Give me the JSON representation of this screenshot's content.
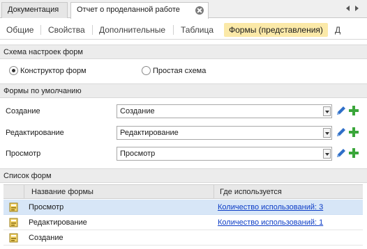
{
  "doc_tabs": [
    {
      "label": "Документация"
    },
    {
      "label": "Отчет о проделанной работе"
    }
  ],
  "prop_tabs": [
    {
      "label": "Общие"
    },
    {
      "label": "Свойства"
    },
    {
      "label": "Дополнительные"
    },
    {
      "label": "Таблица"
    },
    {
      "label": "Формы (представления)"
    },
    {
      "label": "Д"
    }
  ],
  "scheme": {
    "header": "Схема настроек форм",
    "option_constructor": "Конструктор форм",
    "option_simple": "Простая схема",
    "selected": "Конструктор форм"
  },
  "defaults": {
    "header": "Формы по умолчанию",
    "rows": [
      {
        "label": "Создание",
        "value": "Создание"
      },
      {
        "label": "Редактирование",
        "value": "Редактирование"
      },
      {
        "label": "Просмотр",
        "value": "Просмотр"
      }
    ]
  },
  "forms_list": {
    "header": "Список форм",
    "columns": {
      "name": "Название формы",
      "usage": "Где используется"
    },
    "rows": [
      {
        "name": "Просмотр",
        "usage": "Количество использований: 3",
        "selected": true
      },
      {
        "name": "Редактирование",
        "usage": "Количество использований: 1",
        "selected": false
      },
      {
        "name": "Создание",
        "usage": "",
        "selected": false
      }
    ]
  },
  "colors": {
    "active_tab": "#fbe9a8",
    "selected_row": "#d7e6f7",
    "link": "#0b3cc6",
    "plus_green": "#3aa63a",
    "pencil_blue": "#2f6fc8"
  }
}
